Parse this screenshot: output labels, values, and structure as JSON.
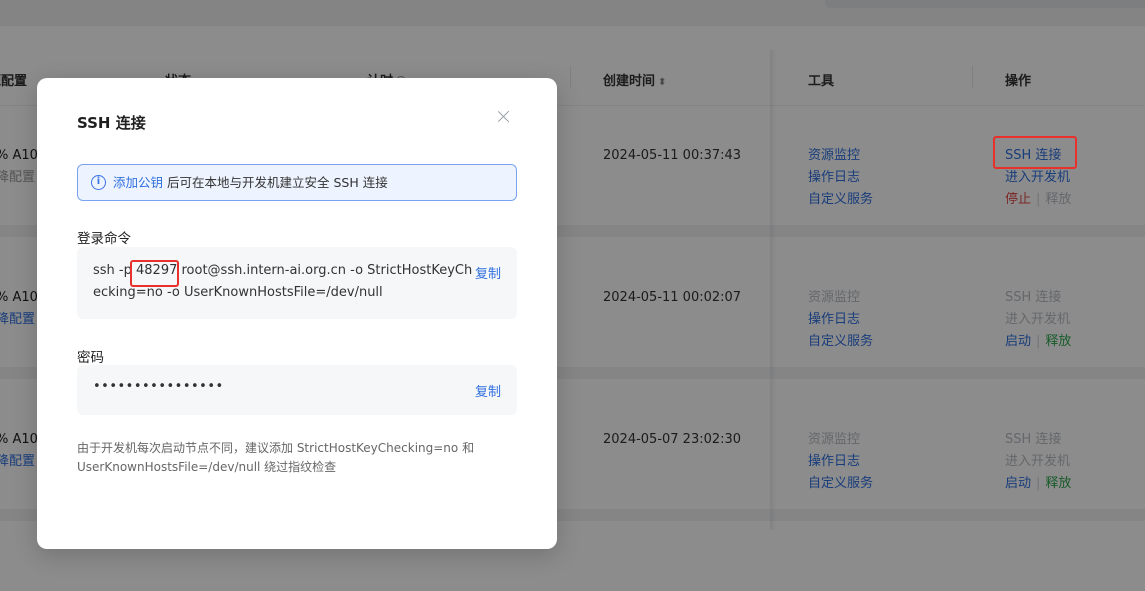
{
  "table": {
    "headers": {
      "resource": "源配置",
      "status": "状态",
      "timing": "计时",
      "created": "创建时间",
      "tools": "工具",
      "actions": "操作"
    },
    "sort_icon": "sort-updown-icon",
    "rows": [
      {
        "gpu": "% A10",
        "gpu_sub": "降配置",
        "created_at": "2024-05-11 00:37:43",
        "tools": [
          "资源监控",
          "操作日志",
          "自定义服务"
        ],
        "ssh": "SSH 连接",
        "enter": "进入开发机",
        "toggle": "停止",
        "release": "释放"
      },
      {
        "gpu": "% A10",
        "gpu_sub": "降配置",
        "created_at": "2024-05-11 00:02:07",
        "tools": [
          "资源监控",
          "操作日志",
          "自定义服务"
        ],
        "ssh": "SSH 连接",
        "enter": "进入开发机",
        "toggle": "启动",
        "release": "释放"
      },
      {
        "gpu": "% A10",
        "gpu_sub": "降配置",
        "created_at": "2024-05-07 23:02:30",
        "tools": [
          "资源监控",
          "操作日志",
          "自定义服务"
        ],
        "ssh": "SSH 连接",
        "enter": "进入开发机",
        "toggle": "启动",
        "release": "释放"
      }
    ]
  },
  "modal": {
    "title": "SSH 连接",
    "close_icon": "close-icon",
    "alert": {
      "icon": "info-icon",
      "link": "添加公钥",
      "text": " 后可在本地与开发机建立安全 SSH 连接"
    },
    "login_label": "登录命令",
    "command": {
      "prefix": "ssh -p ",
      "port": "48297",
      "suffix": " root@ssh.intern-ai.org.cn -o StrictHostKeyChecking=no -o UserKnownHostsFile=/dev/null"
    },
    "copy_label": "复制",
    "password_label": "密码",
    "password_masked": "••••••••••••••••",
    "hint": "由于开发机每次启动节点不同，建议添加 StrictHostKeyChecking=no 和 UserKnownHostsFile=/dev/null 绕过指纹检查"
  },
  "colors": {
    "accent": "#2f6fe0",
    "highlight": "#e8312a",
    "danger": "#e04848",
    "success": "#2fa84f",
    "overlay": "rgba(0,0,0,0.45)"
  }
}
